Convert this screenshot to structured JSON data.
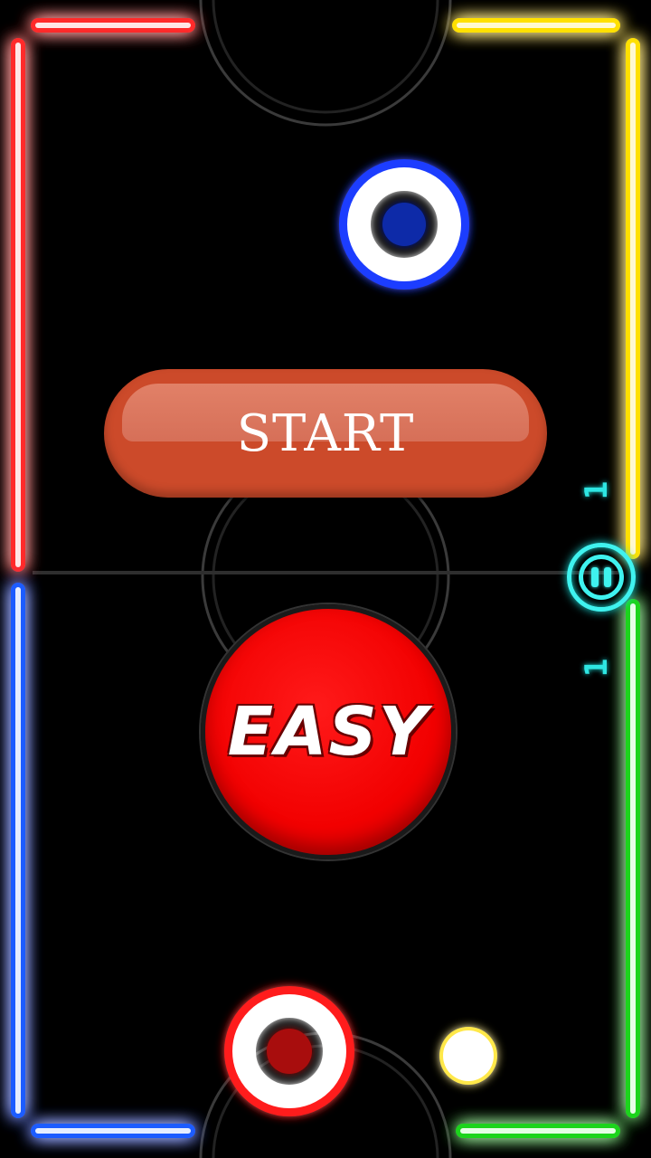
{
  "colors": {
    "background": "#000000",
    "wall_top_left": "#ff2a2a",
    "wall_top_right": "#ffe000",
    "wall_bottom_left": "#1f5bff",
    "wall_bottom_right": "#1ed41e",
    "start_button": "#cc4a2a",
    "easy_button": "#f20000",
    "pause_accent": "#3ff2ef",
    "opponent_mallet": "#1a3cff",
    "player_mallet": "#ff1a1a",
    "puck": "#fff6c8"
  },
  "menu": {
    "start_label": "START",
    "difficulty_label": "EASY"
  },
  "hud": {
    "score_top": "1",
    "score_bottom": "1",
    "pause_icon": "pause-icon"
  }
}
